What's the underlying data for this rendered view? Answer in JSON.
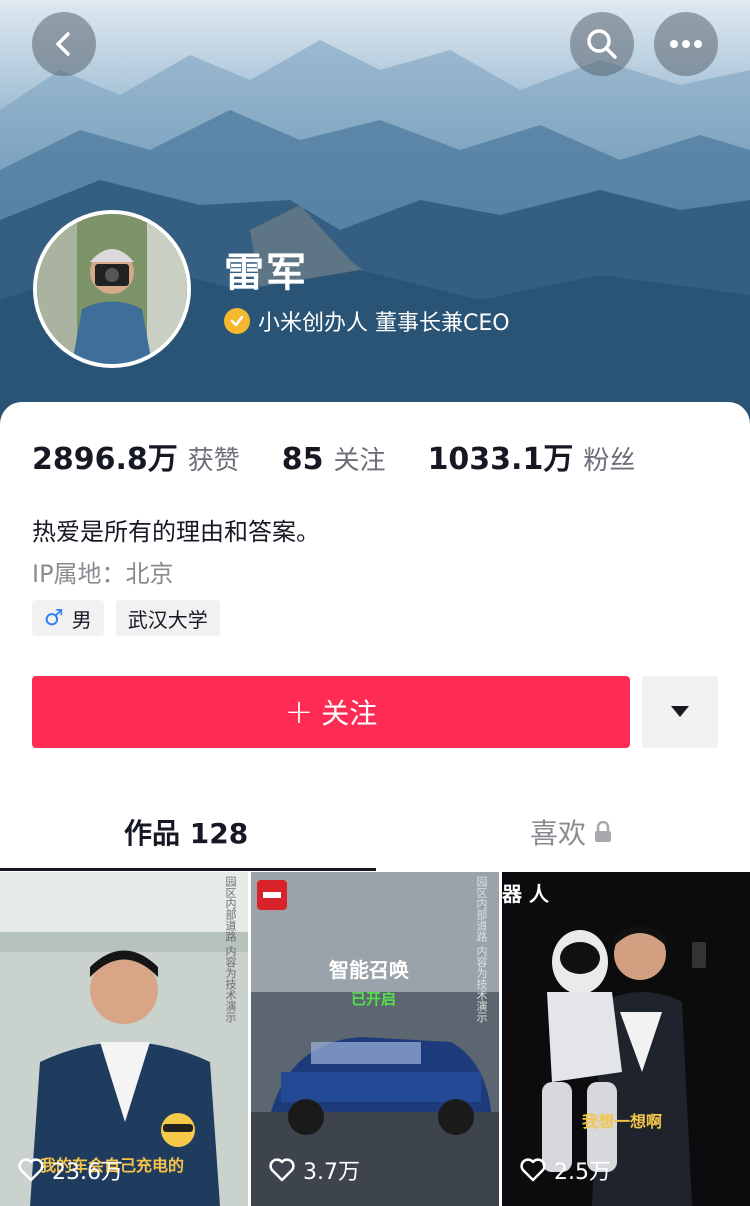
{
  "header": {
    "name": "雷军",
    "title": "小米创办人 董事长兼CEO"
  },
  "stats": [
    {
      "value": "2896.8万",
      "label": "获赞"
    },
    {
      "value": "85",
      "label": "关注"
    },
    {
      "value": "1033.1万",
      "label": "粉丝"
    }
  ],
  "bio": "热爱是所有的理由和答案。",
  "ip_location": "IP属地：北京",
  "tags": {
    "gender": "男",
    "school": "武汉大学"
  },
  "follow_button": {
    "label": "关注"
  },
  "tabs": {
    "works": "作品 128",
    "likes": "喜欢"
  },
  "videos": [
    {
      "likes": "23.6万",
      "caption": "我的车会自己充电的",
      "side_text": "园区内部道路 内容为技术演示"
    },
    {
      "likes": "3.7万",
      "caption_top": "智能召唤",
      "caption_sub": "已开启",
      "side_text": "园区内部道路 内容为技术演示"
    },
    {
      "likes": "2.5万",
      "caption_top": "器 人",
      "caption": "我想一想啊"
    }
  ],
  "colors": {
    "accent": "#fe2c55",
    "verified": "#f5b82e",
    "male": "#2f7ef3"
  }
}
